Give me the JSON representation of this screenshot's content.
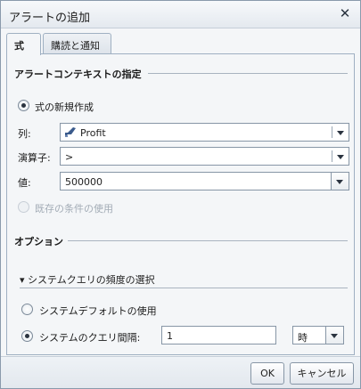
{
  "dialog": {
    "title": "アラートの追加"
  },
  "tabs": [
    {
      "label": "式"
    },
    {
      "label": "購読と通知"
    }
  ],
  "context": {
    "title": "アラートコンテキストの指定",
    "new_expression": "式の新規作成",
    "column_label": "列:",
    "column_value": "Profit",
    "operator_label": "演算子:",
    "operator_value": ">",
    "value_label": "値:",
    "value_value": "500000",
    "existing_condition": "既存の条件の使用"
  },
  "options": {
    "title": "オプション",
    "frequency_toggle": "▾ システムクエリの頻度の選択",
    "use_default": "システムデフォルトの使用",
    "interval_label": "システムのクエリ間隔:",
    "interval_value": "1",
    "interval_unit": "時"
  },
  "footer": {
    "ok": "OK",
    "cancel": "キャンセル"
  }
}
